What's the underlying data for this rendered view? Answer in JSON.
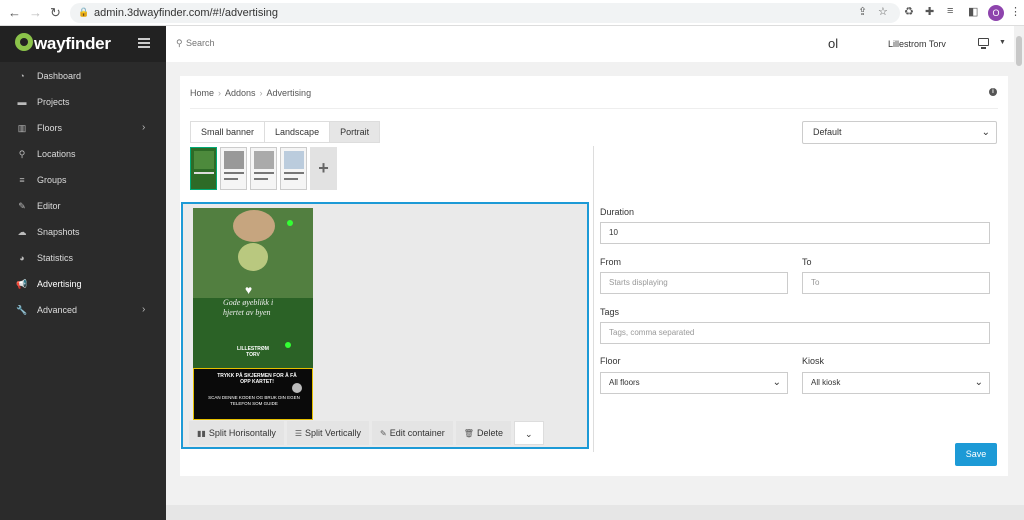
{
  "browser": {
    "url": "admin.3dwayfinder.com/#!/advertising",
    "profile_initial": "O"
  },
  "sidebar": {
    "brand": "wayfinder",
    "items": [
      {
        "label": "Dashboard",
        "icon": "dashboard-icon",
        "chevron": false
      },
      {
        "label": "Projects",
        "icon": "briefcase-icon",
        "chevron": false
      },
      {
        "label": "Floors",
        "icon": "building-icon",
        "chevron": true
      },
      {
        "label": "Locations",
        "icon": "map-pin-icon",
        "chevron": false
      },
      {
        "label": "Groups",
        "icon": "list-icon",
        "chevron": false
      },
      {
        "label": "Editor",
        "icon": "edit-icon",
        "chevron": false
      },
      {
        "label": "Snapshots",
        "icon": "cloud-icon",
        "chevron": false
      },
      {
        "label": "Statistics",
        "icon": "pie-chart-icon",
        "chevron": false
      },
      {
        "label": "Advertising",
        "icon": "megaphone-icon",
        "chevron": false
      },
      {
        "label": "Advanced",
        "icon": "wrench-icon",
        "chevron": true
      }
    ]
  },
  "topbar": {
    "search_placeholder": "Search",
    "user_initials": "ol",
    "location": "Lillestrom Torv"
  },
  "breadcrumb": [
    "Home",
    "Addons",
    "Advertising"
  ],
  "tabs": [
    "Small banner",
    "Landscape",
    "Portrait"
  ],
  "active_tab": "Portrait",
  "editor": {
    "ad": {
      "slogan": "Gode øyeblikk i hjertet av byen",
      "brand": "LILLESTRØM TORV",
      "cta": "TRYKK PÅ SKJERMEN FOR Å FÅ OPP KARTET!",
      "cta_sub": "SCAN DENNE KODEN OG BRUK DIN EGEN TELEFON SOM GUIDE"
    },
    "toolbar": {
      "split_h": "Split Horisontally",
      "split_v": "Split Vertically",
      "edit": "Edit container",
      "delete": "Delete"
    }
  },
  "form": {
    "template_select": "Default",
    "duration_label": "Duration",
    "duration_value": "10",
    "from_label": "From",
    "from_placeholder": "Starts displaying",
    "to_label": "To",
    "to_placeholder": "To",
    "tags_label": "Tags",
    "tags_placeholder": "Tags, comma separated",
    "floor_label": "Floor",
    "floor_value": "All floors",
    "kiosk_label": "Kiosk",
    "kiosk_value": "All kiosk",
    "save_label": "Save"
  }
}
